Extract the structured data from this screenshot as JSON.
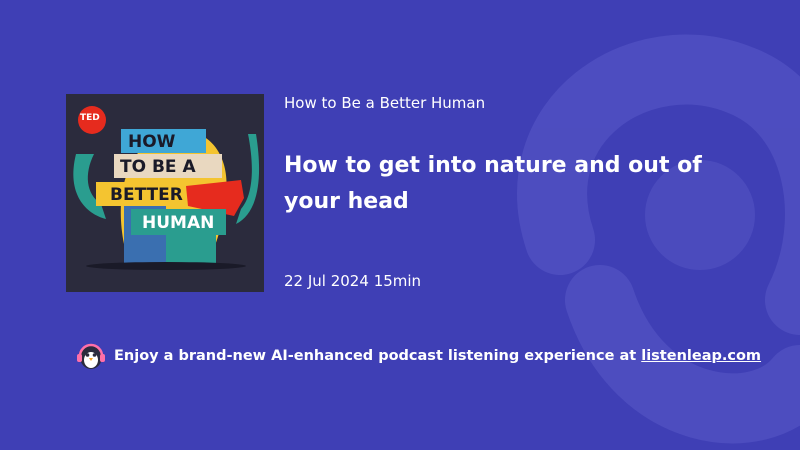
{
  "podcast": {
    "cover_badge": "TED",
    "cover_lines": [
      "HOW",
      "TO BE A",
      "BETTER",
      "HUMAN"
    ],
    "show_title": "How to Be a Better Human",
    "episode_title": "How to get into nature and out of your head",
    "date": "22 Jul 2024",
    "duration": "15min"
  },
  "promo": {
    "text": "Enjoy a brand-new AI-enhanced podcast listening experience at",
    "link_text": "listenleap.com"
  },
  "colors": {
    "background": "#3f3fb5",
    "accent_red": "#e62b1e",
    "accent_yellow": "#f4c430",
    "accent_teal": "#2a9d8f"
  },
  "icons": {
    "mascot": "penguin-headphones-icon",
    "background_mark": "listenleap-logo-icon"
  }
}
